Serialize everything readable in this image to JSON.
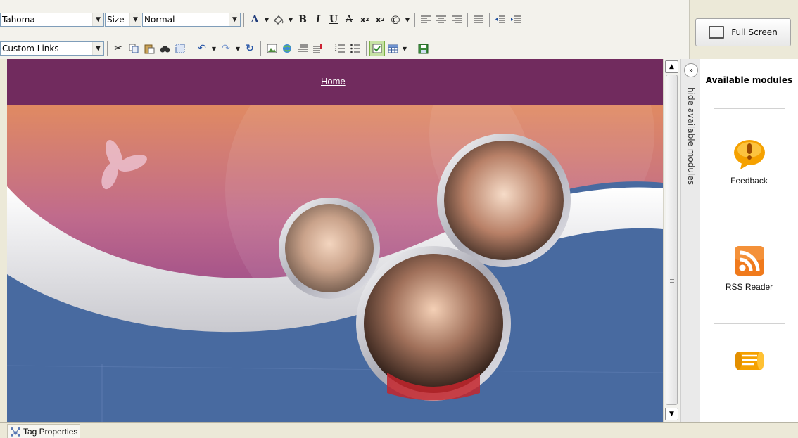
{
  "toolbar": {
    "font_name": "Tahoma",
    "font_size": "Size",
    "format": "Normal",
    "custom_links": "Custom Links",
    "bold": "B",
    "italic": "I",
    "underline": "U"
  },
  "fullscreen": {
    "label": "Full Screen"
  },
  "page": {
    "nav_home": "Home"
  },
  "sidebar": {
    "hide_label": "hide available modules",
    "title": "Available modules",
    "modules": [
      {
        "label": "Feedback",
        "icon": "feedback-icon",
        "color": "#f5a100"
      },
      {
        "label": "RSS Reader",
        "icon": "rss-icon",
        "color": "#f07a1c"
      },
      {
        "label": "",
        "icon": "scroll-icon",
        "color": "#f5a100"
      }
    ]
  },
  "bottom": {
    "tag_properties": "Tag Properties"
  },
  "colors": {
    "nav_bg": "#712b5e",
    "banner_blue": "#486aa0",
    "active_button": "#c6e2a4"
  }
}
